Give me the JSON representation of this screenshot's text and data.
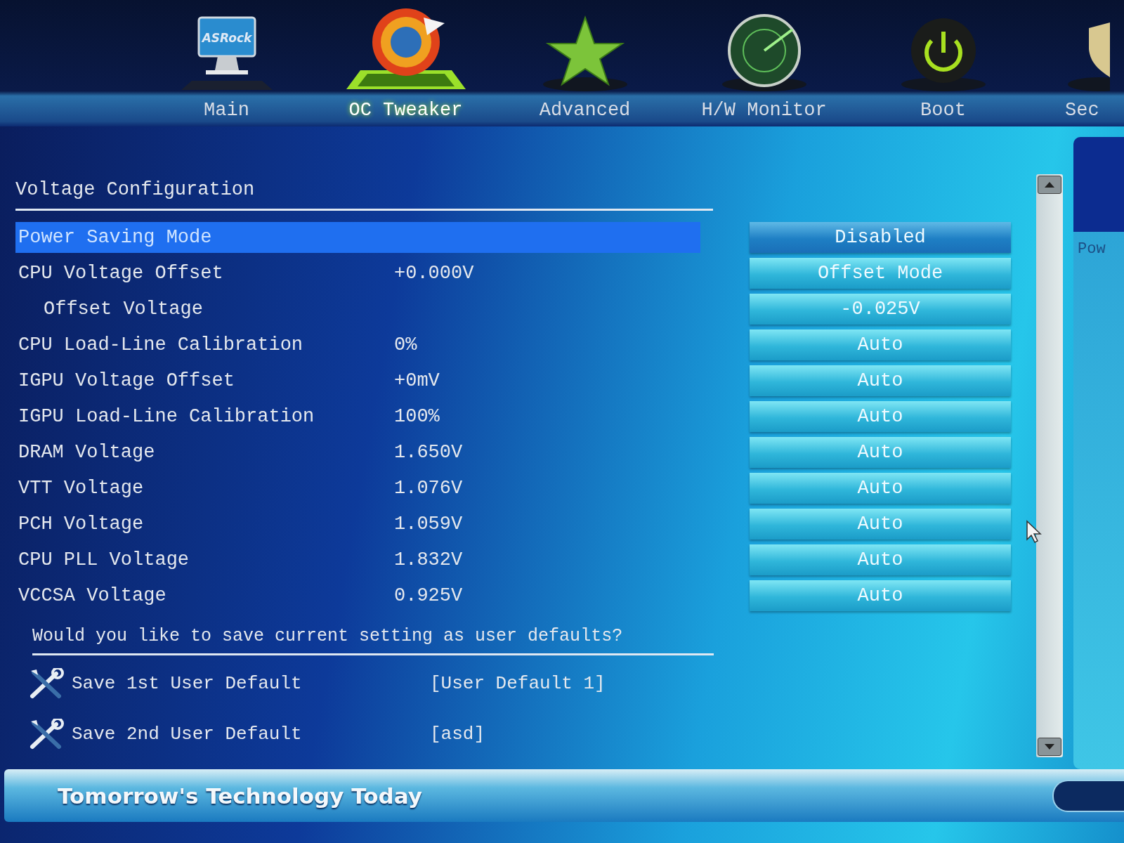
{
  "tabs": [
    {
      "label": "Main",
      "icon_text": "ASRock",
      "selected": false
    },
    {
      "label": "OC Tweaker",
      "selected": true
    },
    {
      "label": "Advanced",
      "selected": false
    },
    {
      "label": "H/W Monitor",
      "selected": false
    },
    {
      "label": "Boot",
      "selected": false
    },
    {
      "label": "Sec",
      "selected": false
    }
  ],
  "section_title": "Voltage Configuration",
  "settings": [
    {
      "name": "Power Saving Mode",
      "setting": "Disabled",
      "selected": true
    },
    {
      "name": "CPU Voltage Offset",
      "value": "+0.000V",
      "setting": "Offset Mode",
      "selected": false,
      "children": [
        {
          "name": "Offset Voltage",
          "setting": "-0.025V",
          "selected": false
        }
      ]
    },
    {
      "name": "CPU Load-Line Calibration",
      "value": "0%",
      "setting": "Auto",
      "selected": false
    },
    {
      "name": "IGPU Voltage Offset",
      "value": "+0mV",
      "setting": "Auto",
      "selected": false
    },
    {
      "name": "IGPU Load-Line Calibration",
      "value": "100%",
      "setting": "Auto",
      "selected": false
    },
    {
      "name": "DRAM Voltage",
      "value": "1.650V",
      "setting": "Auto",
      "selected": false
    },
    {
      "name": "VTT Voltage",
      "value": "1.076V",
      "setting": "Auto",
      "selected": false
    },
    {
      "name": "PCH Voltage",
      "value": "1.059V",
      "setting": "Auto",
      "selected": false
    },
    {
      "name": "CPU PLL Voltage",
      "value": "1.832V",
      "setting": "Auto",
      "selected": false
    },
    {
      "name": "VCCSA Voltage",
      "value": "0.925V",
      "setting": "Auto",
      "selected": false
    }
  ],
  "save_prompt": "Would you like to save current setting as user defaults?",
  "save_items": [
    {
      "label": "Save 1st User Default",
      "value": "[User Default 1]"
    },
    {
      "label": "Save 2nd User Default",
      "value": "[asd]"
    }
  ],
  "help_panel": {
    "text": "Pow"
  },
  "footer": {
    "slogan": "Tomorrow's Technology Today"
  }
}
